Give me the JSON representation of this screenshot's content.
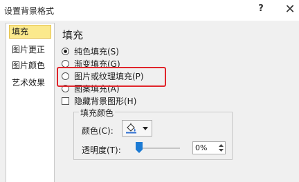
{
  "window": {
    "title": "设置背景格式",
    "help_label": "?",
    "close_label": "✕"
  },
  "sidebar": {
    "items": [
      {
        "label": "填充",
        "selected": true
      },
      {
        "label": "图片更正",
        "selected": false
      },
      {
        "label": "图片颜色",
        "selected": false
      },
      {
        "label": "艺术效果",
        "selected": false
      }
    ]
  },
  "fill": {
    "section_title": "填充",
    "options": [
      {
        "label": "纯色填充(S)",
        "checked": true
      },
      {
        "label": "渐变填充(G)",
        "checked": false
      },
      {
        "label": "图片或纹理填充(P)",
        "checked": false
      },
      {
        "label": "图案填充(A)",
        "checked": false
      }
    ],
    "hide_background": {
      "label": "隐藏背景图形(H)",
      "checked": false
    }
  },
  "fill_color": {
    "group_title": "填充颜色",
    "color_label": "颜色(C):",
    "color_icon": "paint-bucket-icon",
    "transparency_label": "透明度(T):",
    "transparency_percent": 0,
    "transparency_value": "0%"
  },
  "colors": {
    "highlight_border": "#e0252b",
    "selected_nav_bg": "#fbe98d",
    "slider_thumb": "#1c7bd4"
  }
}
